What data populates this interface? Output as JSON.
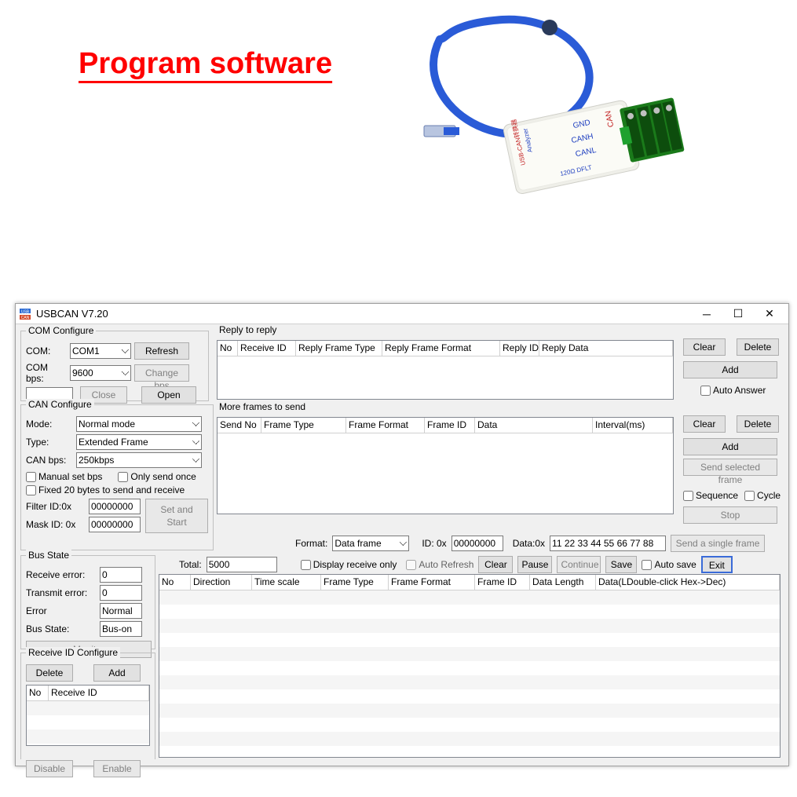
{
  "page_heading": "Program software",
  "device_labels": {
    "line1": "USB-CAN转换器",
    "line2": "Analyzer",
    "gnd": "GND",
    "canh": "CANH",
    "canl": "CANL",
    "rt": "120Ω  DFLT"
  },
  "window": {
    "title": "USBCAN V7.20",
    "icon_name": "usbcan-app-icon"
  },
  "com_configure": {
    "legend": "COM Configure",
    "com_label": "COM:",
    "com_value": "COM1",
    "refresh": "Refresh",
    "bps_label": "COM bps:",
    "bps_value": "9600",
    "change_bps": "Change bps",
    "close": "Close",
    "open": "Open"
  },
  "can_configure": {
    "legend": "CAN Configure",
    "mode_label": "Mode:",
    "mode_value": "Normal mode",
    "type_label": "Type:",
    "type_value": "Extended Frame",
    "bps_label": "CAN bps:",
    "bps_value": "250kbps",
    "manual_bps": "Manual set bps",
    "only_send_once": "Only send once",
    "fixed_20": "Fixed 20 bytes to send and receive",
    "filter_label": "Filter ID:0x",
    "filter_value": "00000000",
    "mask_label": "Mask ID:  0x",
    "mask_value": "00000000",
    "set_start": "Set and Start"
  },
  "bus_state": {
    "legend": "Bus State",
    "rx_err_label": "Receive error:",
    "rx_err_value": "0",
    "tx_err_label": "Transmit error:",
    "tx_err_value": "0",
    "error_label": "Error",
    "error_value": "Normal",
    "state_label": "Bus State:",
    "state_value": "Bus-on",
    "monitor": "Monitor"
  },
  "rx_id_conf": {
    "legend": "Receive ID Configure",
    "delete": "Delete",
    "add": "Add",
    "headers": [
      "No",
      "Receive ID"
    ],
    "disable": "Disable",
    "enable": "Enable"
  },
  "reply_to_reply": {
    "legend": "Reply to reply",
    "headers": [
      "No",
      "Receive ID",
      "Reply Frame Type",
      "Reply Frame Format",
      "Reply  ID",
      "Reply Data"
    ],
    "clear": "Clear",
    "delete": "Delete",
    "add": "Add",
    "auto_answer": "Auto Answer"
  },
  "more_frames": {
    "legend": "More frames to send",
    "headers": [
      "Send No",
      "Frame Type",
      "Frame Format",
      "Frame ID",
      "Data",
      "Interval(ms)"
    ],
    "clear": "Clear",
    "delete": "Delete",
    "add": "Add",
    "send_selected": "Send selected frame",
    "sequence": "Sequence",
    "cycle": "Cycle",
    "stop": "Stop"
  },
  "send_single": {
    "format_label": "Format:",
    "format_value": "Data frame",
    "id_label": "ID: 0x",
    "id_value": "00000000",
    "data_label": "Data:0x",
    "data_value": "11 22 33 44 55 66 77 88",
    "send": "Send a single frame"
  },
  "main_area": {
    "total_label": "Total:",
    "total_value": "5000",
    "display_rx_only": "Display receive only",
    "auto_refresh": "Auto Refresh",
    "clear": "Clear",
    "pause": "Pause",
    "continue": "Continue",
    "save": "Save",
    "auto_save": "Auto save",
    "exit": "Exit",
    "headers": [
      "No",
      "Direction",
      "Time scale",
      "Frame Type",
      "Frame Format",
      "Frame ID",
      "Data Length",
      "Data(LDouble-click Hex->Dec)"
    ]
  }
}
